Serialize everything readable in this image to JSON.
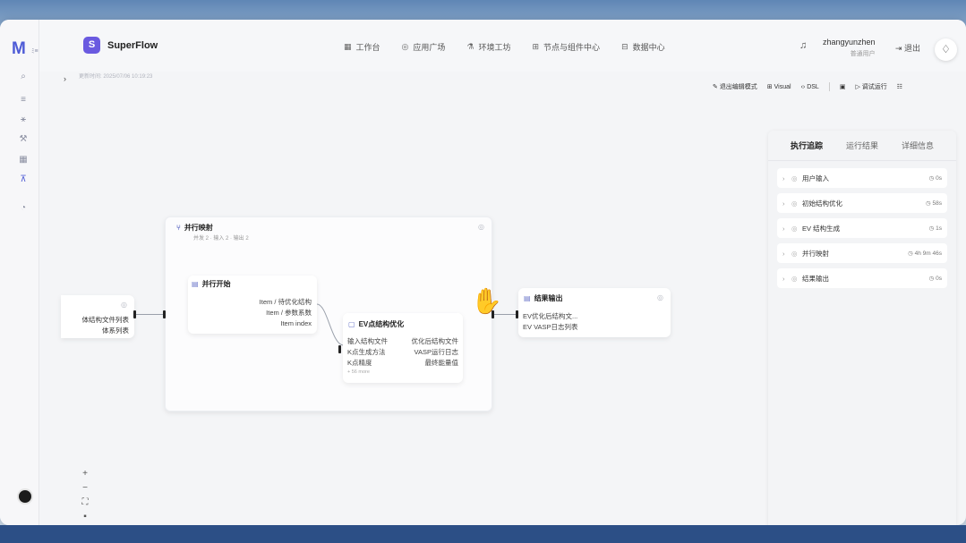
{
  "brand": {
    "logo": "M",
    "logo_sub": "ﾐ≡",
    "badge": "S",
    "name": "SuperFlow"
  },
  "nav": [
    {
      "icon": "grid-icon",
      "glyph": "▦",
      "label": "工作台"
    },
    {
      "icon": "compass-icon",
      "glyph": "◎",
      "label": "应用广场"
    },
    {
      "icon": "flask-icon",
      "glyph": "⚗",
      "label": "环境工坊"
    },
    {
      "icon": "nodes-icon",
      "glyph": "⊞",
      "label": "节点与组件中心"
    },
    {
      "icon": "database-icon",
      "glyph": "⊟",
      "label": "数据中心"
    }
  ],
  "user": {
    "name": "zhangyunzhen",
    "role": "普通用户",
    "logout": "退出"
  },
  "canvas_meta": {
    "update_time": "更新时间: 2025/07/06 10:19:23"
  },
  "toolbar": {
    "edit_mode": "退出编辑模式",
    "visual": "Visual",
    "dsl": "DSL",
    "debug_run": "调试运行"
  },
  "nodes": {
    "partial_left": {
      "rows": [
        "体结构文件列表",
        "体系列表"
      ]
    },
    "parallel_map": {
      "title": "并行映射",
      "meta": "并发 2 · 输入 2 · 输出 2"
    },
    "parallel_start": {
      "title": "并行开始",
      "rows": [
        "Item / 待优化结构",
        "Item / 参数系数",
        "Item index"
      ]
    },
    "ev_opt": {
      "title": "EV点结构优化",
      "rows": [
        {
          "left": "输入结构文件",
          "right": "优化后结构文件"
        },
        {
          "left": "K点生成方法",
          "right": "VASP运行日志"
        },
        {
          "left": "K点精度",
          "right": "最终能量值"
        }
      ],
      "more": "+ 56 more"
    },
    "output": {
      "title": "结果输出",
      "rows": [
        "EV优化后结构文...",
        "EV VASP日志列表"
      ]
    }
  },
  "panel": {
    "tabs": [
      "执行追踪",
      "运行结果",
      "详细信息"
    ],
    "active_tab": "执行追踪",
    "trace": [
      {
        "label": "用户输入",
        "time": "0s"
      },
      {
        "label": "初始结构优化",
        "time": "58s"
      },
      {
        "label": "EV 结构生成",
        "time": "1s"
      },
      {
        "label": "并行映射",
        "time": "4h 9m 46s"
      },
      {
        "label": "结果输出",
        "time": "0s"
      }
    ]
  },
  "zoom": {
    "plus": "+",
    "minus": "−"
  }
}
